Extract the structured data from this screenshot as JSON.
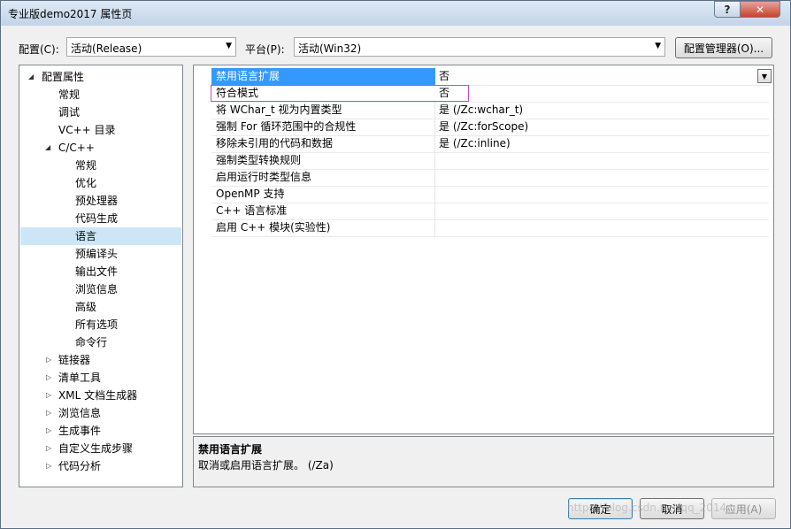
{
  "window": {
    "title": "专业版demo2017 属性页",
    "help_label": "?",
    "close_label": "✕"
  },
  "toolbar": {
    "config_label": "配置(C):",
    "config_value": "活动(Release)",
    "platform_label": "平台(P):",
    "platform_value": "活动(Win32)",
    "manager_label": "配置管理器(O)..."
  },
  "tree": {
    "root": "配置属性",
    "general": "常规",
    "debug": "调试",
    "vcdirs": "VC++ 目录",
    "cpp": "C/C++",
    "cpp_children": [
      "常规",
      "优化",
      "预处理器",
      "代码生成",
      "语言",
      "预编译头",
      "输出文件",
      "浏览信息",
      "高级",
      "所有选项",
      "命令行"
    ],
    "collapsed": [
      "链接器",
      "清单工具",
      "XML 文档生成器",
      "浏览信息",
      "生成事件",
      "自定义生成步骤",
      "代码分析"
    ]
  },
  "grid": {
    "rows": [
      {
        "name": "禁用语言扩展",
        "value": "否"
      },
      {
        "name": "符合模式",
        "value": "否"
      },
      {
        "name": "将 WChar_t 视为内置类型",
        "value": "是 (/Zc:wchar_t)"
      },
      {
        "name": "强制 For 循环范围中的合规性",
        "value": "是 (/Zc:forScope)"
      },
      {
        "name": "移除未引用的代码和数据",
        "value": "是 (/Zc:inline)"
      },
      {
        "name": "强制类型转换规则",
        "value": ""
      },
      {
        "name": "启用运行时类型信息",
        "value": ""
      },
      {
        "name": "OpenMP 支持",
        "value": ""
      },
      {
        "name": "C++ 语言标准",
        "value": ""
      },
      {
        "name": "启用 C++ 模块(实验性)",
        "value": ""
      }
    ]
  },
  "description": {
    "title": "禁用语言扩展",
    "text": "取消或启用语言扩展。     (/Za)"
  },
  "buttons": {
    "ok": "确定",
    "cancel": "取消",
    "apply": "应用(A)"
  },
  "watermark": "https://blog.csdn.net/qq_2014..."
}
